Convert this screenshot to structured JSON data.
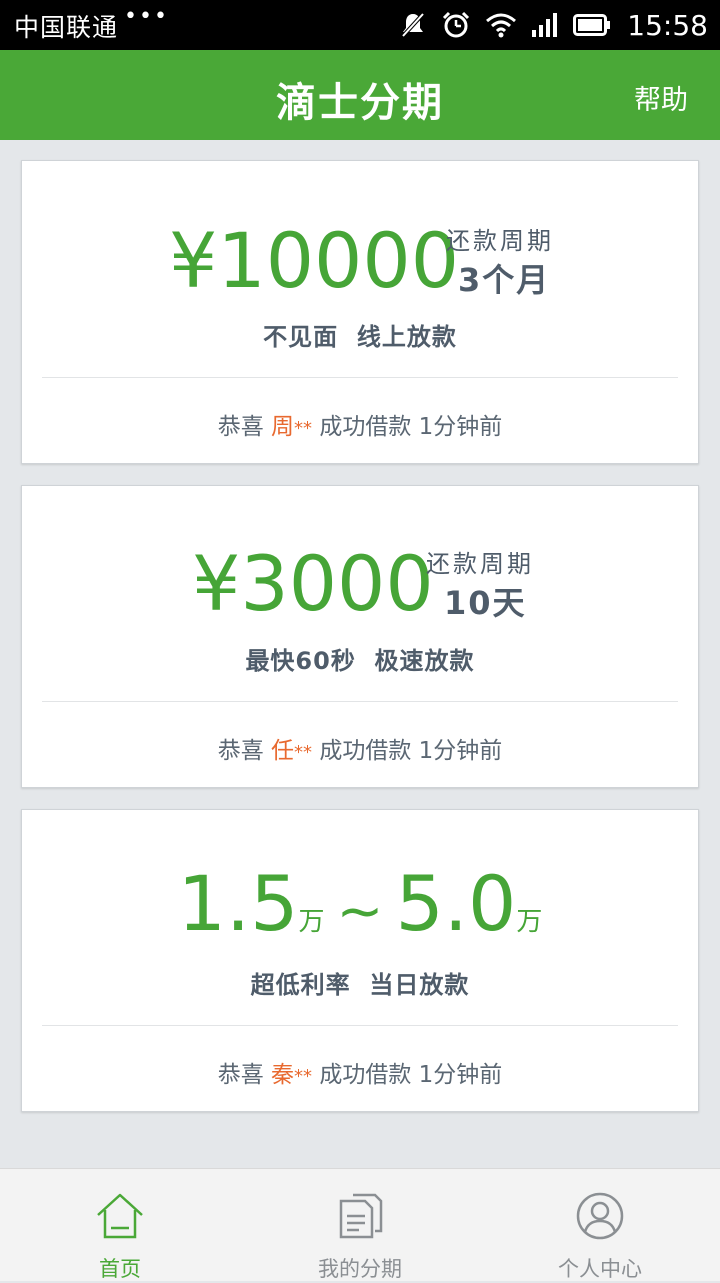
{
  "status_bar": {
    "carrier": "中国联通",
    "dots": "•••",
    "time": "15:58"
  },
  "header": {
    "title": "滴士分期",
    "help": "帮助"
  },
  "cards": [
    {
      "amount": "¥10000",
      "period_label": "还款周期",
      "period_value": "3个月",
      "tagline": "不见面  线上放款",
      "congrats_prefix": "恭喜 ",
      "congrats_name": "周",
      "congrats_stars": "**",
      "congrats_suffix": " 成功借款 1分钟前"
    },
    {
      "amount": "¥3000",
      "period_label": "还款周期",
      "period_value": "10天",
      "tagline": "最快60秒  极速放款",
      "congrats_prefix": "恭喜 ",
      "congrats_name": "任",
      "congrats_stars": "**",
      "congrats_suffix": " 成功借款 1分钟前"
    },
    {
      "range_low": "1.5",
      "range_low_unit": "万",
      "range_sep": "~",
      "range_high": "5.0",
      "range_high_unit": "万",
      "tagline": "超低利率  当日放款",
      "congrats_prefix": "恭喜 ",
      "congrats_name": "秦",
      "congrats_stars": "**",
      "congrats_suffix": " 成功借款 1分钟前"
    }
  ],
  "tabs": [
    {
      "label": "首页",
      "icon": "home-icon",
      "active": true
    },
    {
      "label": "我的分期",
      "icon": "document-icon",
      "active": false
    },
    {
      "label": "个人中心",
      "icon": "user-icon",
      "active": false
    }
  ],
  "colors": {
    "brand_green": "#4aa837",
    "amount_green": "#46a537",
    "highlight_orange": "#e8692f",
    "text_dark": "#4f5c6a"
  }
}
